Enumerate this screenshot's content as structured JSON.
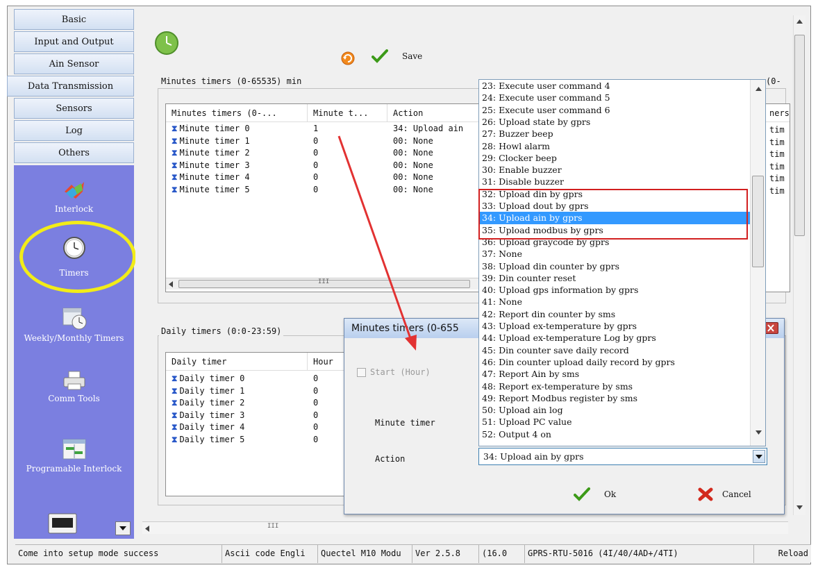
{
  "sidebar": {
    "nav": [
      "Basic",
      "Input and Output",
      "Ain Sensor",
      "Data Transmission",
      "Sensors",
      "Log",
      "Others"
    ],
    "tools": [
      "Interlock",
      "Timers",
      "Weekly/Monthly Timers",
      "Comm Tools",
      "Programable Interlock"
    ]
  },
  "toolbar": {
    "save_label": "Save"
  },
  "minutes_group": {
    "title": "Minutes timers (0-65535) min",
    "right_title": "(0-",
    "columns": [
      "Minutes timers (0-...",
      "Minute t...",
      "Action"
    ],
    "rows": [
      {
        "name": "Minute timer 0",
        "value": "1",
        "action": "34: Upload ain"
      },
      {
        "name": "Minute timer 1",
        "value": "0",
        "action": "00: None"
      },
      {
        "name": "Minute timer 2",
        "value": "0",
        "action": "00: None"
      },
      {
        "name": "Minute timer 3",
        "value": "0",
        "action": "00: None"
      },
      {
        "name": "Minute timer 4",
        "value": "0",
        "action": "00: None"
      },
      {
        "name": "Minute timer 5",
        "value": "0",
        "action": "00: None"
      }
    ],
    "right_header": "ners",
    "right_cells": [
      "tim",
      "tim",
      "tim",
      "tim",
      "tim",
      "tim"
    ]
  },
  "daily_group": {
    "title": "Daily timers (0:0-23:59)",
    "columns": [
      "Daily timer",
      "Hour"
    ],
    "rows": [
      {
        "name": "Daily timer 0",
        "value": "0"
      },
      {
        "name": "Daily timer 1",
        "value": "0"
      },
      {
        "name": "Daily timer 2",
        "value": "0"
      },
      {
        "name": "Daily timer 3",
        "value": "0"
      },
      {
        "name": "Daily timer 4",
        "value": "0"
      },
      {
        "name": "Daily timer 5",
        "value": "0"
      }
    ]
  },
  "dialog": {
    "title": "Minutes timers (0-655",
    "start_label": "Start (Hour)",
    "minute_label": "Minute timer",
    "action_label": "Action",
    "ok_label": "Ok",
    "cancel_label": "Cancel"
  },
  "dropdown": {
    "selected_index": 11,
    "items": [
      "23: Execute user command 4",
      "24: Execute user command 5",
      "25: Execute user command 6",
      "26: Upload state by gprs",
      "27: Buzzer beep",
      "28: Howl alarm",
      "29: Clocker beep",
      "30: Enable buzzer",
      "31: Disable buzzer",
      "32: Upload din by gprs",
      "33: Upload dout by gprs",
      "34: Upload ain by gprs",
      "35: Upload modbus by gprs",
      "36: Upload graycode by gprs",
      "37: None",
      "38: Upload din counter by gprs",
      "39: Din counter reset",
      "40: Upload gps information by gprs",
      "41: None",
      "42: Report din counter by sms",
      "43: Upload ex-temperature by gprs",
      "44: Upload ex-temperature Log by gprs",
      "45: Din counter save daily record",
      "46: Din counter upload daily record by gprs",
      "47: Report Ain by sms",
      "48: Report ex-temperature by sms",
      "49: Report Modbus register by sms",
      "50: Upload ain log",
      "51: Upload PC value",
      "52: Output 4 on"
    ],
    "combo_value": "34: Upload ain by gprs"
  },
  "status": {
    "cells": [
      "Come into setup mode success",
      "Ascii code Engli",
      "Quectel M10 Modu",
      "Ver 2.5.8",
      "(16.0",
      "GPRS-RTU-5016 (4I/40/4AD+/4TI)",
      "Reload"
    ]
  },
  "scroll_glyph": "III",
  "colors": {
    "sidebar_tools": "#7b7fe0",
    "selection": "#3399ff",
    "highlight_box": "#d21f1f",
    "annotation_ellipse": "#f2ec18",
    "arrow": "#e23232"
  }
}
